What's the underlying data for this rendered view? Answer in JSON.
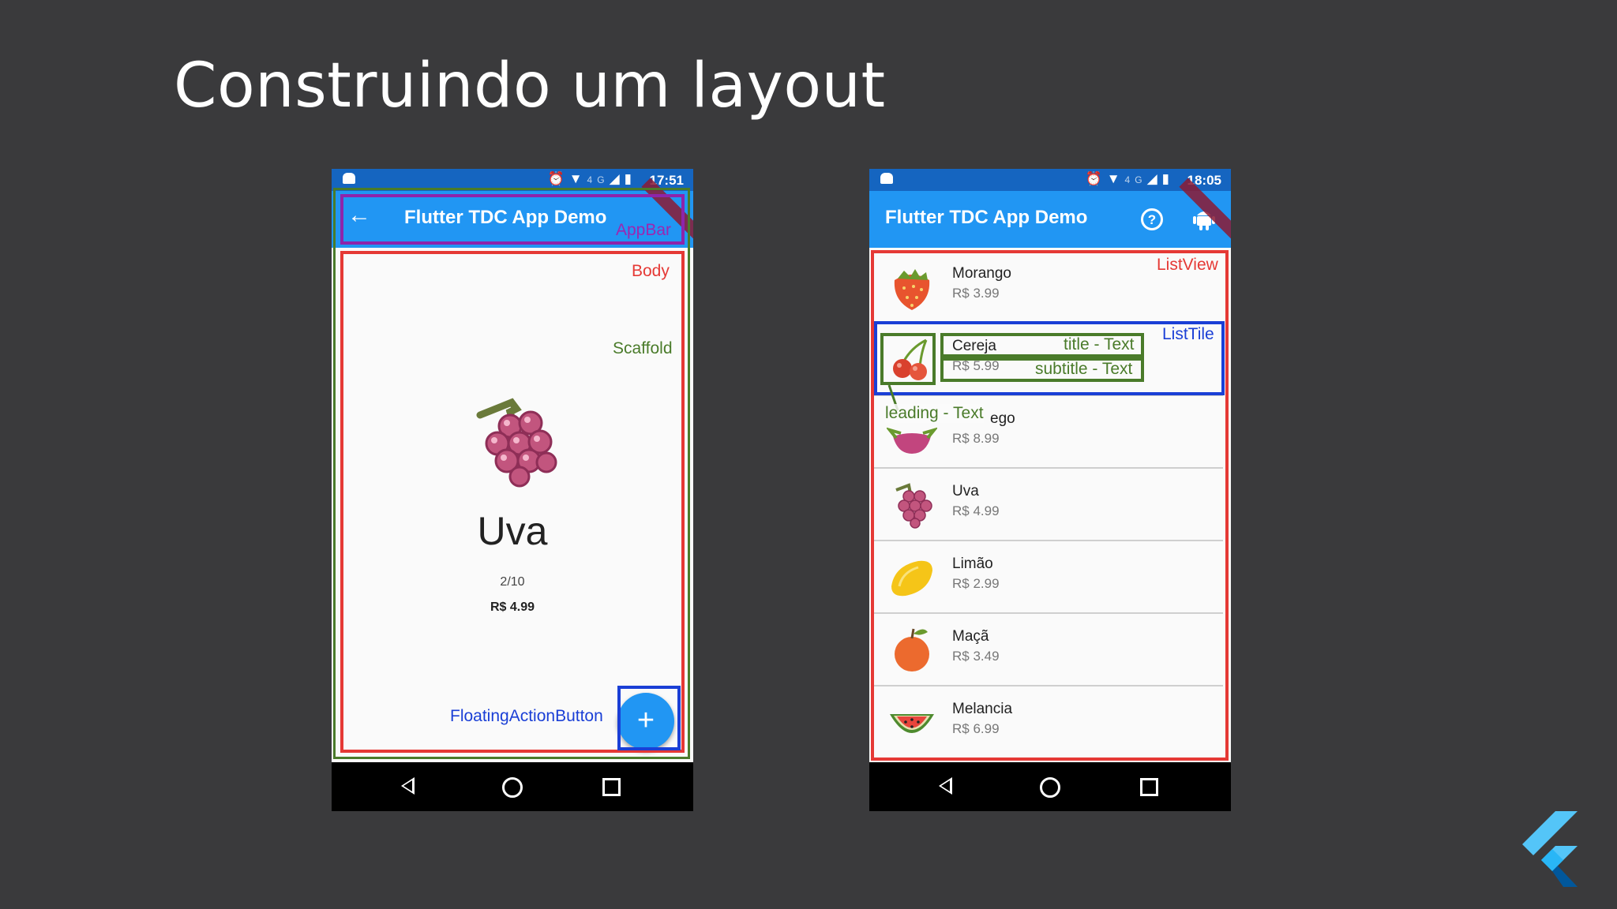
{
  "slide": {
    "title": "Construindo um layout"
  },
  "phone1": {
    "status_time": "17:51",
    "status_net": "4G",
    "appbar_title": "Flutter TDC App Demo",
    "product": {
      "name": "Uva",
      "count": "2/10",
      "price": "R$ 4.99"
    },
    "fab_label": "+",
    "labels": {
      "appbar": "AppBar",
      "body": "Body",
      "scaffold": "Scaffold",
      "fab": "FloatingActionButton"
    }
  },
  "phone2": {
    "status_time": "18:05",
    "status_net": "4G",
    "appbar_title": "Flutter TDC App Demo",
    "items": [
      {
        "title": "Morango",
        "subtitle": "R$ 3.99",
        "icon": "strawberry-icon"
      },
      {
        "title": "Cereja",
        "subtitle": "R$ 5.99",
        "icon": "cherry-icon"
      },
      {
        "title": "ego",
        "subtitle": "R$ 8.99",
        "icon": "pitaya-icon"
      },
      {
        "title": "Uva",
        "subtitle": "R$ 4.99",
        "icon": "grape-icon"
      },
      {
        "title": "Limão",
        "subtitle": "R$ 2.99",
        "icon": "lemon-icon"
      },
      {
        "title": "Maçã",
        "subtitle": "R$ 3.49",
        "icon": "apple-icon"
      },
      {
        "title": "Melancia",
        "subtitle": "R$ 6.99",
        "icon": "watermelon-icon"
      }
    ],
    "labels": {
      "listview": "ListView",
      "listtile": "ListTile",
      "title": "title - Text",
      "subtitle": "subtitle - Text",
      "leading": "leading - Text"
    }
  },
  "colors": {
    "appbar": "#2196f3",
    "statusbar": "#1565c0",
    "body_outline": "#e53935",
    "scaffold_outline": "#4a7b2a",
    "appbar_outline": "#8e24aa",
    "fab_outline": "#1a3fd6",
    "background": "#3a3a3c"
  }
}
